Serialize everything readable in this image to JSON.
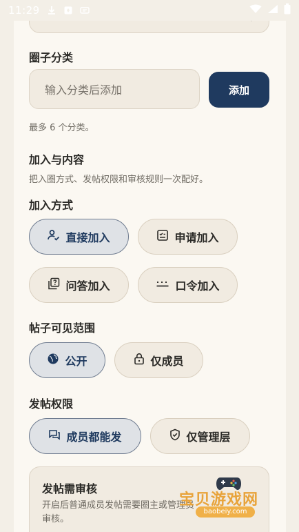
{
  "status_bar": {
    "time": "11:29"
  },
  "category": {
    "title": "圈子分类",
    "input_placeholder": "输入分类后添加",
    "add_label": "添加",
    "hint": "最多 6 个分类。"
  },
  "join_content": {
    "title": "加入与内容",
    "desc": "把入圈方式、发帖权限和审核规则一次配好。"
  },
  "join_mode": {
    "title": "加入方式",
    "options": [
      {
        "label": "直接加入",
        "icon": "person-check-icon",
        "selected": true
      },
      {
        "label": "申请加入",
        "icon": "application-icon",
        "selected": false
      },
      {
        "label": "问答加入",
        "icon": "question-icon",
        "selected": false
      },
      {
        "label": "口令加入",
        "icon": "password-icon",
        "selected": false
      }
    ]
  },
  "visibility": {
    "title": "帖子可见范围",
    "options": [
      {
        "label": "公开",
        "icon": "globe-icon",
        "selected": true
      },
      {
        "label": "仅成员",
        "icon": "lock-icon",
        "selected": false
      }
    ]
  },
  "post_permission": {
    "title": "发帖权限",
    "options": [
      {
        "label": "成员都能发",
        "icon": "chat-icon",
        "selected": true
      },
      {
        "label": "仅管理层",
        "icon": "shield-icon",
        "selected": false
      }
    ]
  },
  "review": {
    "title": "发帖需审核",
    "desc": "开启后普通成员发帖需要圈主或管理员审核。"
  },
  "watermark": {
    "text": "宝贝游戏网",
    "url": "baobeiy.com"
  },
  "colors": {
    "accent": "#1f3a5f",
    "background": "#fbf8f2",
    "chip": "#f1ebe1"
  }
}
